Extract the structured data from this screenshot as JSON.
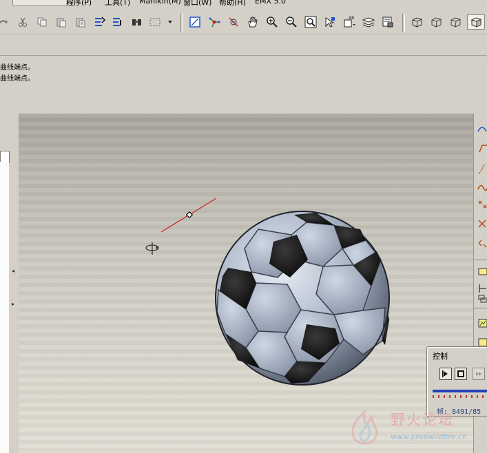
{
  "menu": {
    "items": [
      "程序(P)",
      "工具(T)",
      "Manikin(M)",
      "窗口(W)",
      "帮助(H)",
      "EMX 5.0"
    ]
  },
  "toolbar": {
    "buttons": [
      "redo-icon",
      "cut-icon",
      "copy-icon",
      "paste-icon",
      "paste-special-icon",
      "regenerate-icon",
      "regenerate-manager-icon",
      "find-icon",
      "selection-box-icon",
      "dropdown-arrow-icon",
      "repaint-icon",
      "spin-center-icon",
      "orient-mode-icon",
      "pan-hand-icon",
      "zoom-in-icon",
      "zoom-out-icon",
      "refit-icon",
      "reorient-icon",
      "saved-views-icon",
      "layers-icon",
      "model-setup-icon",
      "wireframe-icon",
      "hidden-line-icon",
      "no-hidden-icon",
      "shading-icon"
    ]
  },
  "messages": [
    "曲线端点。",
    "曲线端点。"
  ],
  "control_panel": {
    "title": "控制",
    "frame_text": "帧: 8491/85"
  },
  "watermark": {
    "brand_text": "野火论坛",
    "url_text": "www.proewildfire.cn"
  },
  "colors": {
    "accent_blue": "#2440b8",
    "tick_red": "#c0392b",
    "ui_gray": "#d4d0c8"
  }
}
